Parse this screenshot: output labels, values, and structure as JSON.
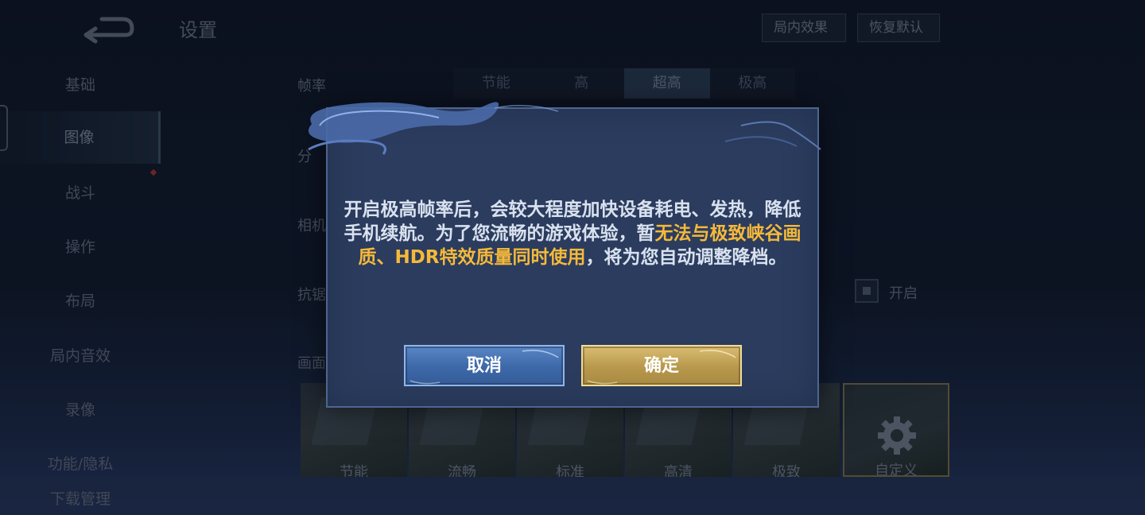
{
  "header": {
    "title": "设置",
    "ingame_effects_label": "局内效果",
    "restore_default_label": "恢复默认"
  },
  "sidebar": {
    "items": [
      {
        "label": "基础"
      },
      {
        "label": "图像"
      },
      {
        "label": "战斗"
      },
      {
        "label": "操作"
      },
      {
        "label": "布局"
      },
      {
        "label": "局内音效"
      },
      {
        "label": "录像"
      },
      {
        "label": "功能/隐私"
      },
      {
        "label": "下载管理"
      }
    ],
    "active": "图像"
  },
  "settings": {
    "frame_rate_label": "帧率",
    "frame_rate_options": [
      "节能",
      "高",
      "超高",
      "极高"
    ],
    "frame_rate_selected": "超高",
    "row2_label": "分",
    "row3_label": "相机",
    "row4_label": "抗锯",
    "row5_label": "画面",
    "toggle_label": "开启",
    "quality_options": [
      "节能",
      "流畅",
      "标准",
      "高清",
      "极致",
      "自定义"
    ]
  },
  "dialog": {
    "message_parts": [
      {
        "text": "开启极高帧率后，会较大程度加快设备耗电、发热，降低手机续航。为了您流畅的游戏体验，暂",
        "highlight": false
      },
      {
        "text": "无法与极致峡谷画质、HDR特效质量同时使用",
        "highlight": true
      },
      {
        "text": "，将为您自动调整降档。",
        "highlight": false
      }
    ],
    "cancel_label": "取消",
    "confirm_label": "确定"
  },
  "colors": {
    "highlight": "#f5b93a",
    "cancel_button": "#4a78b8",
    "confirm_button": "#c9ab5e",
    "dialog_bg": "#2b3c5e"
  }
}
